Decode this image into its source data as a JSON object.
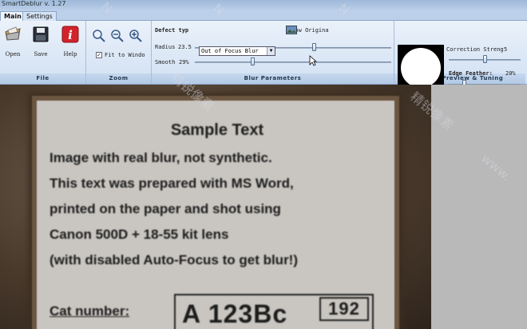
{
  "window": {
    "title": "SmartDeblur v. 1.27"
  },
  "tabs": [
    {
      "label": "Main"
    },
    {
      "label": "Settings"
    }
  ],
  "file_group": {
    "label": "File",
    "buttons": [
      {
        "label": "Open",
        "icon": "open-icon"
      },
      {
        "label": "Save",
        "icon": "save-icon"
      },
      {
        "label": "Help",
        "icon": "help-icon"
      }
    ]
  },
  "zoom_group": {
    "label": "Zoom",
    "icons": [
      "zoom-fit-icon",
      "zoom-out-icon",
      "zoom-in-icon"
    ],
    "fit_to_window_label": "Fit to Windo",
    "fit_to_window_checked": true
  },
  "blur_group": {
    "label": "Blur Parameters",
    "defect_type_label": "Defect typ",
    "defect_type_value": "Out of Focus Blur",
    "show_original_label": "Show Origina",
    "radius_label": "Radius",
    "radius_value": "23.5",
    "smooth_label": "Smooth",
    "smooth_value": "29%",
    "radius_fraction": 0.61,
    "smooth_fraction": 0.29
  },
  "kernel_group": {
    "label": "Kernel Preview & Tuning",
    "correction_label": "Correction Streng",
    "correction_value": "5",
    "edge_feather_label": "Edge Feather:",
    "edge_feather_value": "20%",
    "correction_fraction": 0.5,
    "edge_feather_fraction": 0.2
  },
  "document": {
    "title": "Sample Text",
    "lines": [
      "Image with real blur, not synthetic.",
      "This text was prepared with MS Word,",
      "printed on the paper and shot using",
      "Canon 500D + 18-55 kit lens",
      "(with disabled Auto-Focus to get blur!)"
    ],
    "cat_label": "Cat number:",
    "cat_value": "A 123Bc",
    "cat_small": "192"
  },
  "watermarks": [
    "N",
    "N",
    "N",
    "精锐像素",
    "精锐像素",
    "www."
  ]
}
